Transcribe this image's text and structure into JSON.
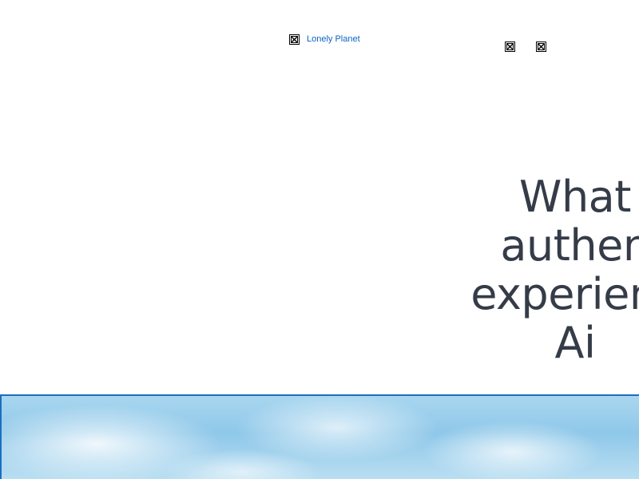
{
  "header": {
    "logo_link_text": "Lonely Planet"
  },
  "hero": {
    "headline_lines": [
      "What",
      "authen",
      "experienc",
      "Ai"
    ]
  },
  "icons": {
    "broken_image": "broken-image-icon"
  }
}
